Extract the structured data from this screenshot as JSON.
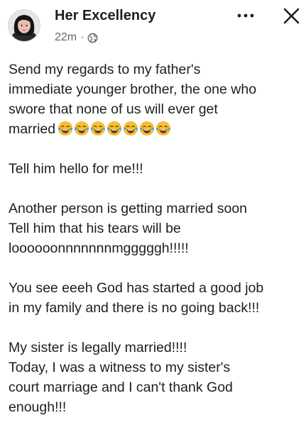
{
  "post": {
    "author_name": "Her Excellency",
    "timestamp": "22m",
    "separator": "·",
    "privacy_icon": "globe-icon",
    "more_icon": "more-options-icon",
    "close_icon": "close-icon"
  },
  "body": {
    "line_1": "Send my regards to my father's",
    "line_2": "immediate younger brother, the one who",
    "line_3": "swore that none of us will ever get",
    "line_4": "married",
    "emoji_name": "face-with-tears-of-joy",
    "emoji_count": 7,
    "line_5": "Tell him hello for me!!!",
    "line_6": "Another person is getting married soon",
    "line_7": "Tell him that his tears will be",
    "line_8": "loooooonnnnnnnmgggggh!!!!!",
    "line_9": "You see eeeh God has started a good job",
    "line_10": "in my family and there is no going back!!!",
    "line_11": "My sister is legally married!!!!",
    "line_12": "Today, I was a witness to my sister's",
    "line_13": "court marriage and I can't thank God",
    "line_14": "enough!!!"
  },
  "colors": {
    "text": "#1c1e21",
    "secondary_text": "#65676b",
    "emoji_face": "#f9c02e"
  }
}
